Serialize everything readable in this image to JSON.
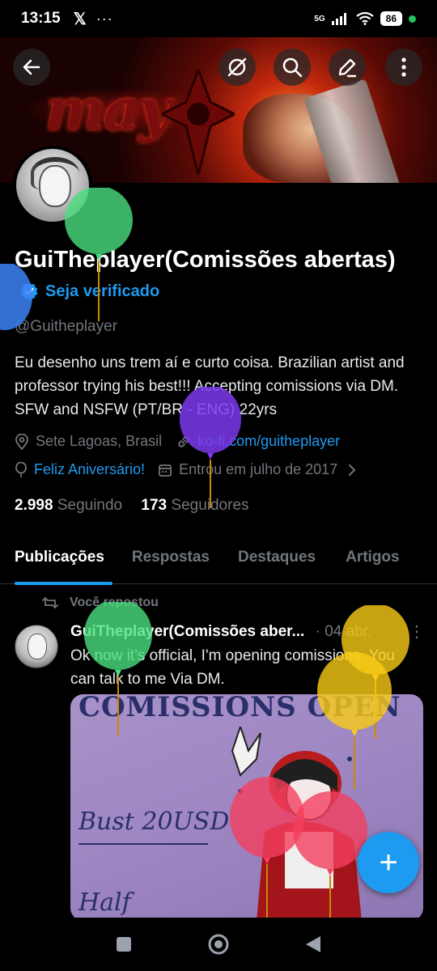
{
  "status_bar": {
    "time": "13:15",
    "x_logo": "𝕏",
    "more": "···",
    "network": "5G",
    "battery": "86"
  },
  "banner": {
    "art_text": "may"
  },
  "profile": {
    "name": "GuiTheplayer(Comissões abertas)",
    "verify_label": "Seja verificado",
    "handle": "@Guitheplayer",
    "bio": "Eu desenho uns trem aí e curto coisa.  Brazilian artist and professor trying his best!!! Accepting comissions via DM. SFW and NSFW (PT/BR - ENG) 22yrs",
    "location": "Sete Lagoas, Brasil",
    "link": "ko-fi.com/guitheplayer",
    "birthday": "Feliz Aniversário!",
    "joined": "Entrou em julho de 2017",
    "following_count": "2.998",
    "following_label": "Seguindo",
    "followers_count": "173",
    "followers_label": "Seguidores"
  },
  "tabs": [
    {
      "label": "Publicações",
      "active": true
    },
    {
      "label": "Respostas",
      "active": false
    },
    {
      "label": "Destaques",
      "active": false
    },
    {
      "label": "Artigos",
      "active": false
    }
  ],
  "post": {
    "repost_label": "Você repostou",
    "author": "GuiTheplayer(Comissões aber...",
    "date": "· 04 abr.",
    "more": "⋮",
    "text": "Ok now it's official, I'm opening comissions. You can talk to me Via DM.",
    "media_title": "COMISSIONS OPEN",
    "media_bust": "Bust 20USD",
    "media_half": "Half"
  },
  "fab_label": "+",
  "colors": {
    "accent": "#1d9bf0",
    "background": "#000000",
    "muted": "#71767b"
  },
  "icons": [
    "back-arrow-icon",
    "hide-icon",
    "search-icon",
    "edit-icon",
    "more-vertical-icon",
    "verified-badge-icon",
    "location-icon",
    "link-icon",
    "balloon-icon",
    "calendar-icon",
    "chevron-right-icon",
    "repost-icon",
    "compose-icon",
    "nav-square-icon",
    "nav-circle-icon",
    "nav-triangle-icon"
  ]
}
